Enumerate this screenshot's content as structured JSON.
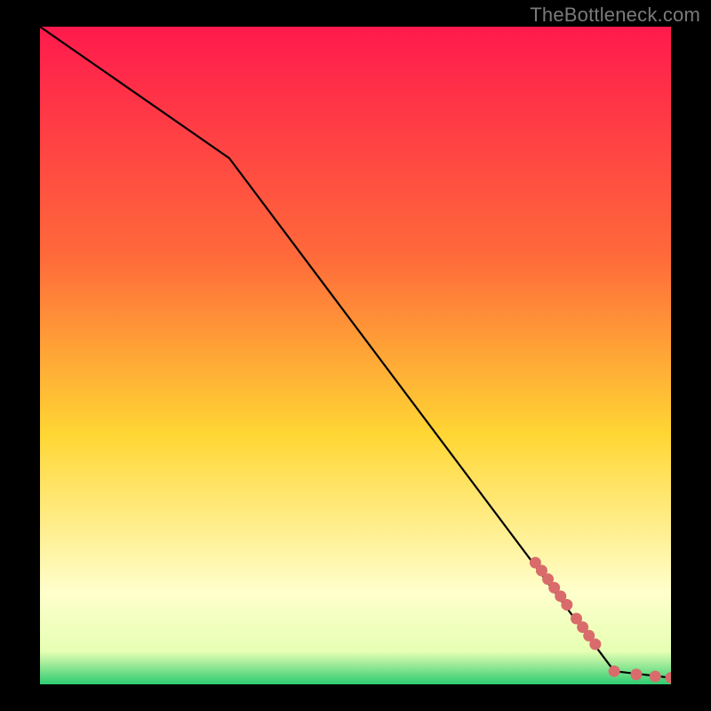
{
  "watermark": "TheBottleneck.com",
  "colors": {
    "line": "#000000",
    "marker_fill": "#d96b6b",
    "marker_stroke": "#b85555",
    "grad_top": "#ff1a4d",
    "grad_upper": "#ff6a3a",
    "grad_mid": "#ffd633",
    "grad_lower": "#ffffcc",
    "grad_green": "#2ecc71",
    "background": "#000000"
  },
  "chart_data": {
    "type": "line",
    "title": "",
    "xlabel": "",
    "ylabel": "",
    "xlim": [
      0,
      100
    ],
    "ylim": [
      0,
      100
    ],
    "line_points": [
      {
        "x": 0,
        "y": 100
      },
      {
        "x": 30,
        "y": 80
      },
      {
        "x": 91,
        "y": 2
      },
      {
        "x": 100,
        "y": 1
      }
    ],
    "markers": [
      {
        "x": 78.5,
        "y": 18.5
      },
      {
        "x": 79.5,
        "y": 17.3
      },
      {
        "x": 80.5,
        "y": 16.0
      },
      {
        "x": 81.5,
        "y": 14.7
      },
      {
        "x": 82.5,
        "y": 13.4
      },
      {
        "x": 83.5,
        "y": 12.1
      },
      {
        "x": 85.0,
        "y": 10.0
      },
      {
        "x": 86.0,
        "y": 8.7
      },
      {
        "x": 87.0,
        "y": 7.4
      },
      {
        "x": 88.0,
        "y": 6.1
      },
      {
        "x": 91.0,
        "y": 2.0
      },
      {
        "x": 94.5,
        "y": 1.5
      },
      {
        "x": 97.5,
        "y": 1.2
      },
      {
        "x": 100.0,
        "y": 1.0
      }
    ]
  }
}
